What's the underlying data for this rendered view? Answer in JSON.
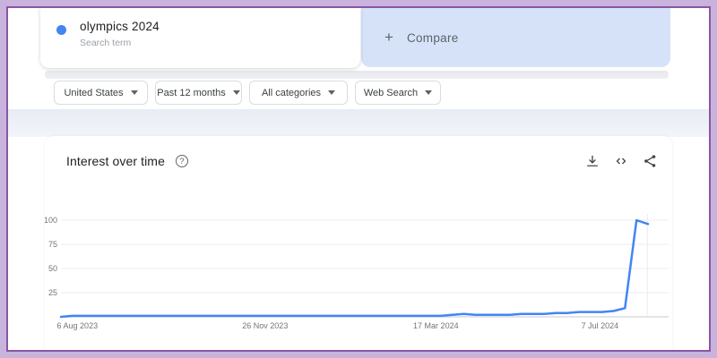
{
  "frame": {
    "outer_color": "#c9b2dc",
    "border_color": "#8b55a6"
  },
  "header": {
    "term_card": {
      "term": "olympics 2024",
      "subtitle": "Search term",
      "dot_color": "#4285f4"
    },
    "compare_card": {
      "plus": "+",
      "label": "Compare",
      "bg_color": "#d5e2f8"
    }
  },
  "filters": [
    {
      "label": "United States"
    },
    {
      "label": "Past 12 months"
    },
    {
      "label": "All categories"
    },
    {
      "label": "Web Search"
    }
  ],
  "section": {
    "title": "Interest over time",
    "help_glyph": "?"
  },
  "chart_data": {
    "type": "line",
    "title": "Interest over time",
    "series": [
      {
        "name": "olympics 2024",
        "color": "#4285f4",
        "values": [
          0,
          1,
          1,
          1,
          1,
          1,
          1,
          1,
          1,
          1,
          1,
          1,
          1,
          1,
          1,
          1,
          1,
          1,
          1,
          1,
          1,
          1,
          1,
          1,
          1,
          1,
          1,
          1,
          1,
          1,
          1,
          1,
          1,
          1,
          2,
          3,
          2,
          2,
          2,
          2,
          3,
          3,
          3,
          4,
          4,
          5,
          5,
          5,
          6,
          9,
          100,
          96
        ]
      }
    ],
    "x_tick_labels": [
      "6 Aug 2023",
      "26 Nov 2023",
      "17 Mar 2024",
      "7 Jul 2024"
    ],
    "x_tick_fracs": [
      0.027,
      0.336,
      0.617,
      0.887
    ],
    "y_ticks": [
      25,
      50,
      75,
      100
    ],
    "ylim": [
      0,
      100
    ],
    "grid": "horizontal",
    "extra_vline_frac": 0.965,
    "axis_color": "#dadce0",
    "grid_color": "#ececec",
    "tick_label_color": "#70757a"
  }
}
